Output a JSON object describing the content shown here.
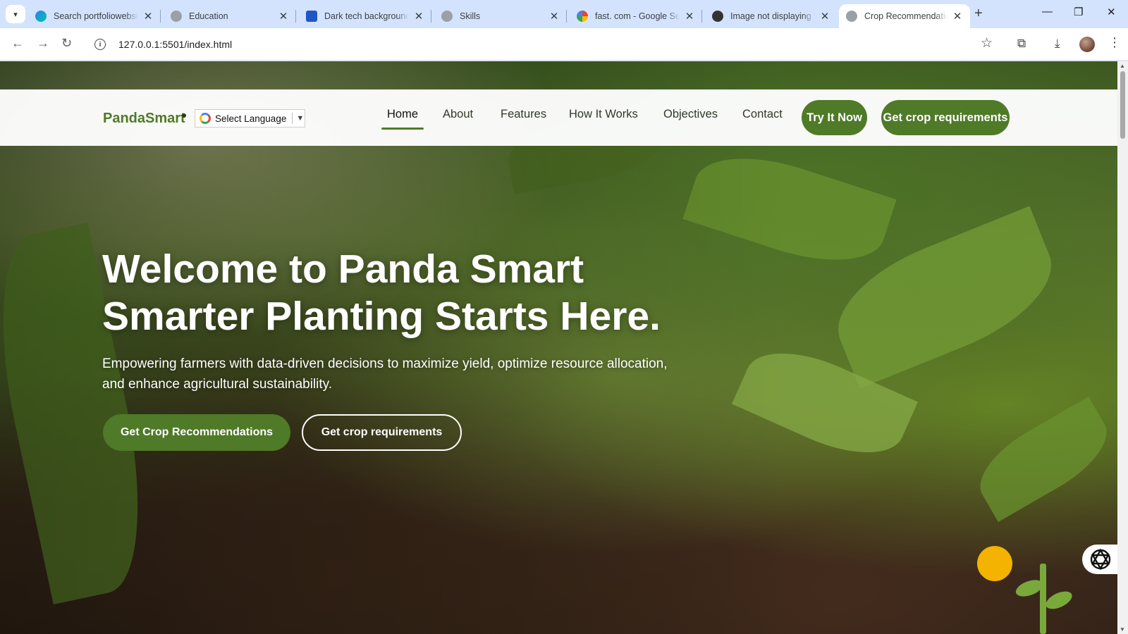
{
  "browser": {
    "tabs": [
      {
        "title": "Search portfoliowebsit",
        "icon": "copilot-icon"
      },
      {
        "title": "Education",
        "icon": "globe-icon"
      },
      {
        "title": "Dark tech background",
        "icon": "doc-icon"
      },
      {
        "title": "Skills",
        "icon": "globe-icon"
      },
      {
        "title": "fast. com - Google Sea",
        "icon": "google-icon"
      },
      {
        "title": "Image not displaying f",
        "icon": "openai-icon"
      },
      {
        "title": "Crop Recommendation",
        "icon": "globe-icon"
      }
    ],
    "url": "127.0.0.1:5501/index.html"
  },
  "site": {
    "brand": "PandaSmart",
    "language_select": "Select Language",
    "nav": [
      "Home",
      "About",
      "Features",
      "How It Works",
      "Objectives",
      "Contact"
    ],
    "active_nav": "Home",
    "cta_try": "Try It Now",
    "cta_requirements": "Get crop requirements"
  },
  "hero": {
    "title_line1": "Welcome to Panda Smart",
    "title_line2": "Smarter Planting Starts Here.",
    "subtitle": "Empowering farmers with data-driven decisions to maximize yield, optimize resource allocation, and enhance agricultural sustainability.",
    "primary_button": "Get Crop Recommendations",
    "secondary_button": "Get crop requirements"
  },
  "colors": {
    "brand_green": "#4f7a28",
    "sun_yellow": "#f3b300",
    "tabstrip": "#d3e3fd"
  }
}
